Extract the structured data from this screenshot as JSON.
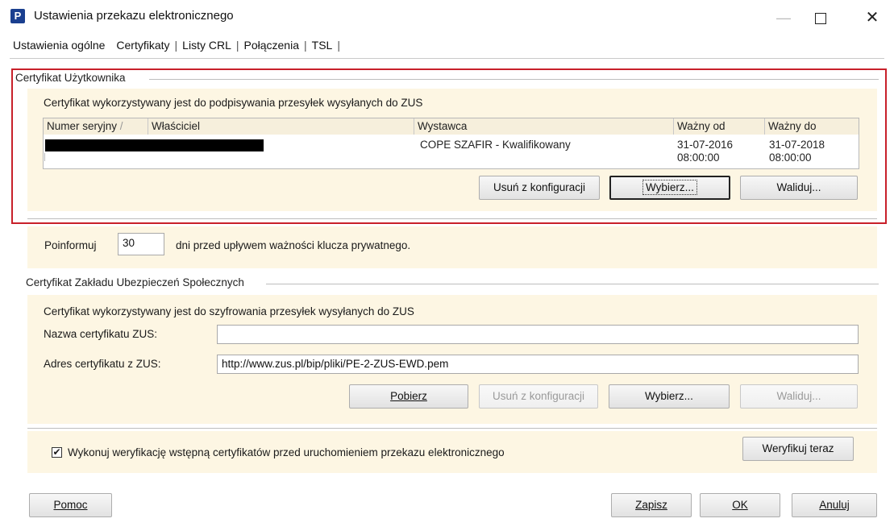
{
  "window": {
    "title": "Ustawienia przekazu elektronicznego",
    "app_icon": "P",
    "min_glyph": "—",
    "close_glyph": "✕"
  },
  "tabs": [
    {
      "label": "Ustawienia ogólne"
    },
    {
      "label": "Certyfikaty"
    },
    {
      "label": "Listy CRL"
    },
    {
      "label": "Połączenia"
    },
    {
      "label": "TSL"
    }
  ],
  "user_cert": {
    "group_label": "Certyfikat Użytkownika",
    "description": "Certyfikat wykorzystywany jest do podpisywania przesyłek wysyłanych do ZUS",
    "columns": [
      "Numer seryjny",
      "Właściciel",
      "Wystawca",
      "Ważny od",
      "Ważny do"
    ],
    "sort_indicator": "/",
    "rows": [
      {
        "serial": "",
        "owner": "",
        "issuer": "COPE SZAFIR - Kwalifikowany",
        "valid_from_date": "31-07-2016",
        "valid_from_time": "08:00:00",
        "valid_to_date": "31-07-2018",
        "valid_to_time": "08:00:00"
      }
    ],
    "btn_remove": "Usuń z konfiguracji",
    "btn_choose": "Wybierz...",
    "btn_validate": "Waliduj..."
  },
  "notify": {
    "prefix": "Poinformuj",
    "days": "30",
    "suffix": "dni przed upływem ważności klucza prywatnego."
  },
  "zus_cert": {
    "group_label": "Certyfikat Zakładu Ubezpieczeń Społecznych",
    "description": "Certyfikat wykorzystywany jest do szyfrowania przesyłek wysyłanych do ZUS",
    "name_label": "Nazwa certyfikatu ZUS:",
    "name_value": "",
    "address_label": "Adres certyfikatu z ZUS:",
    "address_value": "http://www.zus.pl/bip/pliki/PE-2-ZUS-EWD.pem",
    "btn_download": "Pobierz",
    "btn_remove": "Usuń z konfiguracji",
    "btn_choose": "Wybierz...",
    "btn_validate": "Waliduj..."
  },
  "verify": {
    "checked": true,
    "check_glyph": "✔",
    "label": "Wykonuj weryfikację wstępną certyfikatów przed uruchomieniem przekazu elektronicznego",
    "btn_verify_now": "Weryfikuj teraz"
  },
  "footer": {
    "help": "Pomoc",
    "save": "Zapisz",
    "ok": "OK",
    "cancel": "Anuluj"
  },
  "colors": {
    "panel_bg": "#fdf6e3",
    "highlight_border": "#c8202a"
  }
}
